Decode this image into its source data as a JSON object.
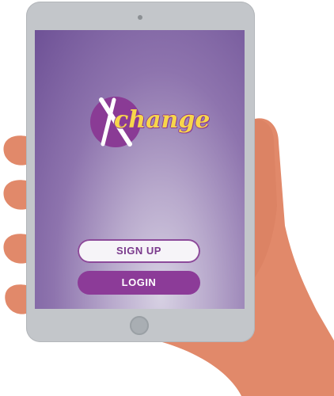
{
  "app": {
    "logo_text": "change",
    "brand_color": "#8a3b95",
    "logo_text_color": "#f7d64a"
  },
  "buttons": {
    "signup_label": "SIGN UP",
    "login_label": "LOGIN"
  },
  "icons": {
    "logo": "xchange-logo-icon",
    "home": "home-button-icon",
    "camera": "front-camera-icon"
  }
}
